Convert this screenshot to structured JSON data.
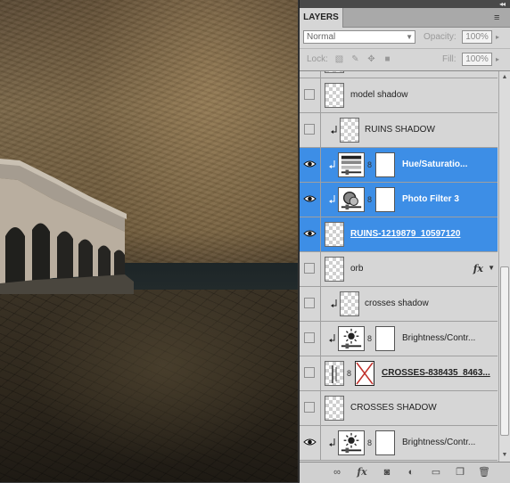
{
  "panel": {
    "tab_label": "LAYERS",
    "collapse_glyph": "◂◂",
    "menu_glyph": "≡",
    "blend_mode": "Normal",
    "opacity_label": "Opacity:",
    "opacity_value": "100%",
    "lock_label": "Lock:",
    "fill_label": "Fill:",
    "fill_value": "100%"
  },
  "layers": [
    {
      "name": "model shadow",
      "visible": false,
      "clipped": false,
      "selected": false,
      "kind": "pixel"
    },
    {
      "name": "RUINS SHADOW",
      "visible": false,
      "clipped": true,
      "selected": false,
      "kind": "pixel"
    },
    {
      "name": "Hue/Saturatio...",
      "visible": true,
      "clipped": true,
      "selected": true,
      "kind": "hue-saturation"
    },
    {
      "name": "Photo Filter 3",
      "visible": true,
      "clipped": true,
      "selected": true,
      "kind": "photo-filter"
    },
    {
      "name": "RUINS-1219879_10597120",
      "visible": true,
      "clipped": false,
      "selected": true,
      "kind": "smart"
    },
    {
      "name": "orb",
      "visible": false,
      "clipped": false,
      "selected": false,
      "kind": "pixel",
      "fx": "fx"
    },
    {
      "name": "crosses shadow",
      "visible": false,
      "clipped": true,
      "selected": false,
      "kind": "pixel"
    },
    {
      "name": "Brightness/Contr...",
      "visible": false,
      "clipped": true,
      "selected": false,
      "kind": "brightness"
    },
    {
      "name": "CROSSES-838435_8463...",
      "visible": false,
      "clipped": false,
      "selected": false,
      "kind": "smart-masked"
    },
    {
      "name": "CROSSES SHADOW",
      "visible": false,
      "clipped": false,
      "selected": false,
      "kind": "pixel"
    },
    {
      "name": "Brightness/Contr...",
      "visible": true,
      "clipped": true,
      "selected": false,
      "kind": "brightness"
    }
  ],
  "bottom_icons": [
    "link-layers-icon",
    "fx-icon",
    "add-mask-icon",
    "adjustment-layer-icon",
    "new-group-icon",
    "new-layer-icon",
    "delete-layer-icon"
  ],
  "colors": {
    "selection": "#3d8ee6",
    "panel": "#d6d6d6"
  }
}
